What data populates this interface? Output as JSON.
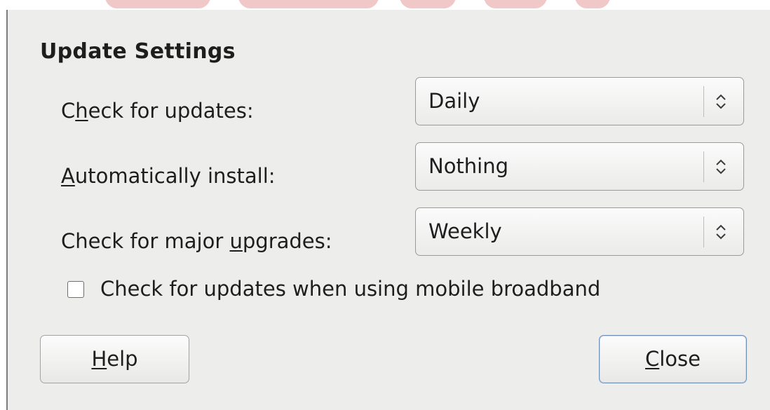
{
  "section": {
    "title": "Update Settings"
  },
  "rows": [
    {
      "label_pre": "C",
      "label_accel": "h",
      "label_post": "eck for updates:",
      "value": "Daily"
    },
    {
      "label_pre": "",
      "label_accel": "A",
      "label_post": "utomatically install:",
      "value": "Nothing"
    },
    {
      "label_pre": "Check for major ",
      "label_accel": "u",
      "label_post": "pgrades:",
      "value": "Weekly"
    }
  ],
  "checkbox": {
    "label": "Check for updates when using mobile broadband",
    "checked": false
  },
  "buttons": {
    "help": {
      "accel": "H",
      "rest": "elp"
    },
    "close": {
      "accel": "C",
      "rest": "lose"
    }
  },
  "icons": {
    "combo_arrow": "up-down-chevron-icon"
  },
  "colors": {
    "dialog_bg": "#ededec",
    "banner_stroke": "#f0c8c8",
    "focus_border": "#6f8fb4"
  }
}
